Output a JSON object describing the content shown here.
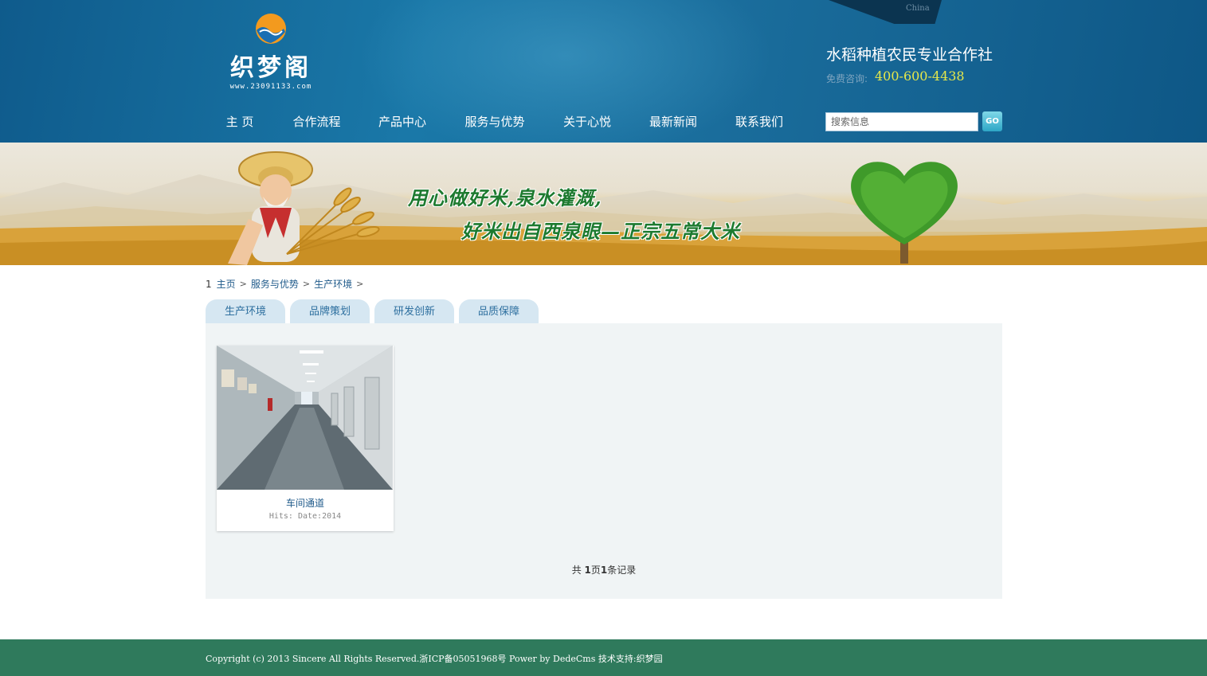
{
  "header": {
    "lang": "China",
    "logo_text": "织梦阁",
    "logo_url": "www.23091133.com",
    "coop_name": "水稻种植农民专业合作社",
    "hotline_label": "免费咨询:",
    "hotline_number": "400-600-4438",
    "search_placeholder": "搜索信息",
    "go_label": "GO"
  },
  "nav": [
    {
      "label": "主 页"
    },
    {
      "label": "合作流程"
    },
    {
      "label": "产品中心"
    },
    {
      "label": "服务与优势"
    },
    {
      "label": "关于心悦"
    },
    {
      "label": "最新新闻"
    },
    {
      "label": "联系我们"
    }
  ],
  "banner": {
    "slogan_line1": "用心做好米,泉水灌溉,",
    "slogan_line2": "好米出自西泉眼—正宗五常大米"
  },
  "breadcrumb": {
    "prefix": "1",
    "items": [
      "主页",
      "服务与优势",
      "生产环境"
    ]
  },
  "tabs": [
    {
      "label": "生产环境"
    },
    {
      "label": "品牌策划"
    },
    {
      "label": "研发创新"
    },
    {
      "label": "品质保障"
    }
  ],
  "products": [
    {
      "title": "车间通道",
      "meta": "Hits: Date:2014"
    }
  ],
  "pager": {
    "prefix": "共 ",
    "pages": "1",
    "mid": "页",
    "records": "1",
    "suffix": "条记录"
  },
  "footer": {
    "copyright": "Copyright (c) 2013 Sincere All Rights Reserved.浙ICP备05051968号 Power by DedeCms  技术支持:织梦园"
  },
  "colors": {
    "header_blue": "#1a6d9c",
    "footer_green": "#2f7a5c",
    "tab_bg": "#d6e7f2",
    "panel_bg": "#f0f4f5",
    "hotline_yellow": "#e6e84a"
  }
}
